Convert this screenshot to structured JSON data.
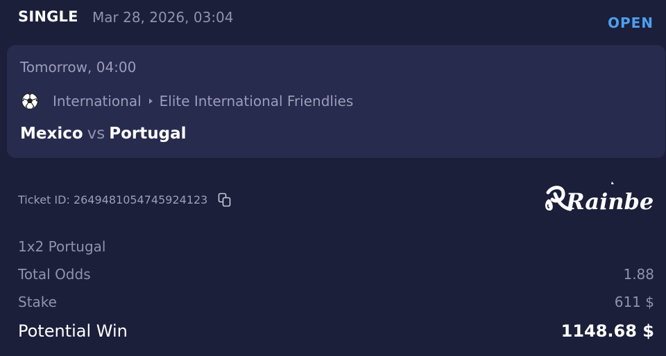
{
  "header": {
    "bet_type": "SINGLE",
    "placed_at": "Mar 28, 2026, 03:04",
    "status": "OPEN",
    "status_color": "#4d9ff0"
  },
  "event": {
    "start_time": "Tomorrow, 04:00",
    "sport_icon": "soccer-ball-icon",
    "country": "International",
    "league": "Elite International Friendlies",
    "home_team": "Mexico",
    "vs_label": "vs",
    "away_team": "Portugal"
  },
  "ticket": {
    "label": "Ticket ID: 2649481054745924123",
    "copy_icon": "copy-icon"
  },
  "brand": {
    "logo_text": "Rainbet"
  },
  "details": {
    "selection": "1x2 Portugal",
    "total_odds_label": "Total Odds",
    "total_odds_value": "1.88",
    "stake_label": "Stake",
    "stake_value": "611 $",
    "potential_win_label": "Potential Win",
    "potential_win_value": "1148.68 $"
  },
  "colors": {
    "background": "#1b1f3a",
    "card": "#272b4e",
    "muted_text": "#8f93ad"
  }
}
